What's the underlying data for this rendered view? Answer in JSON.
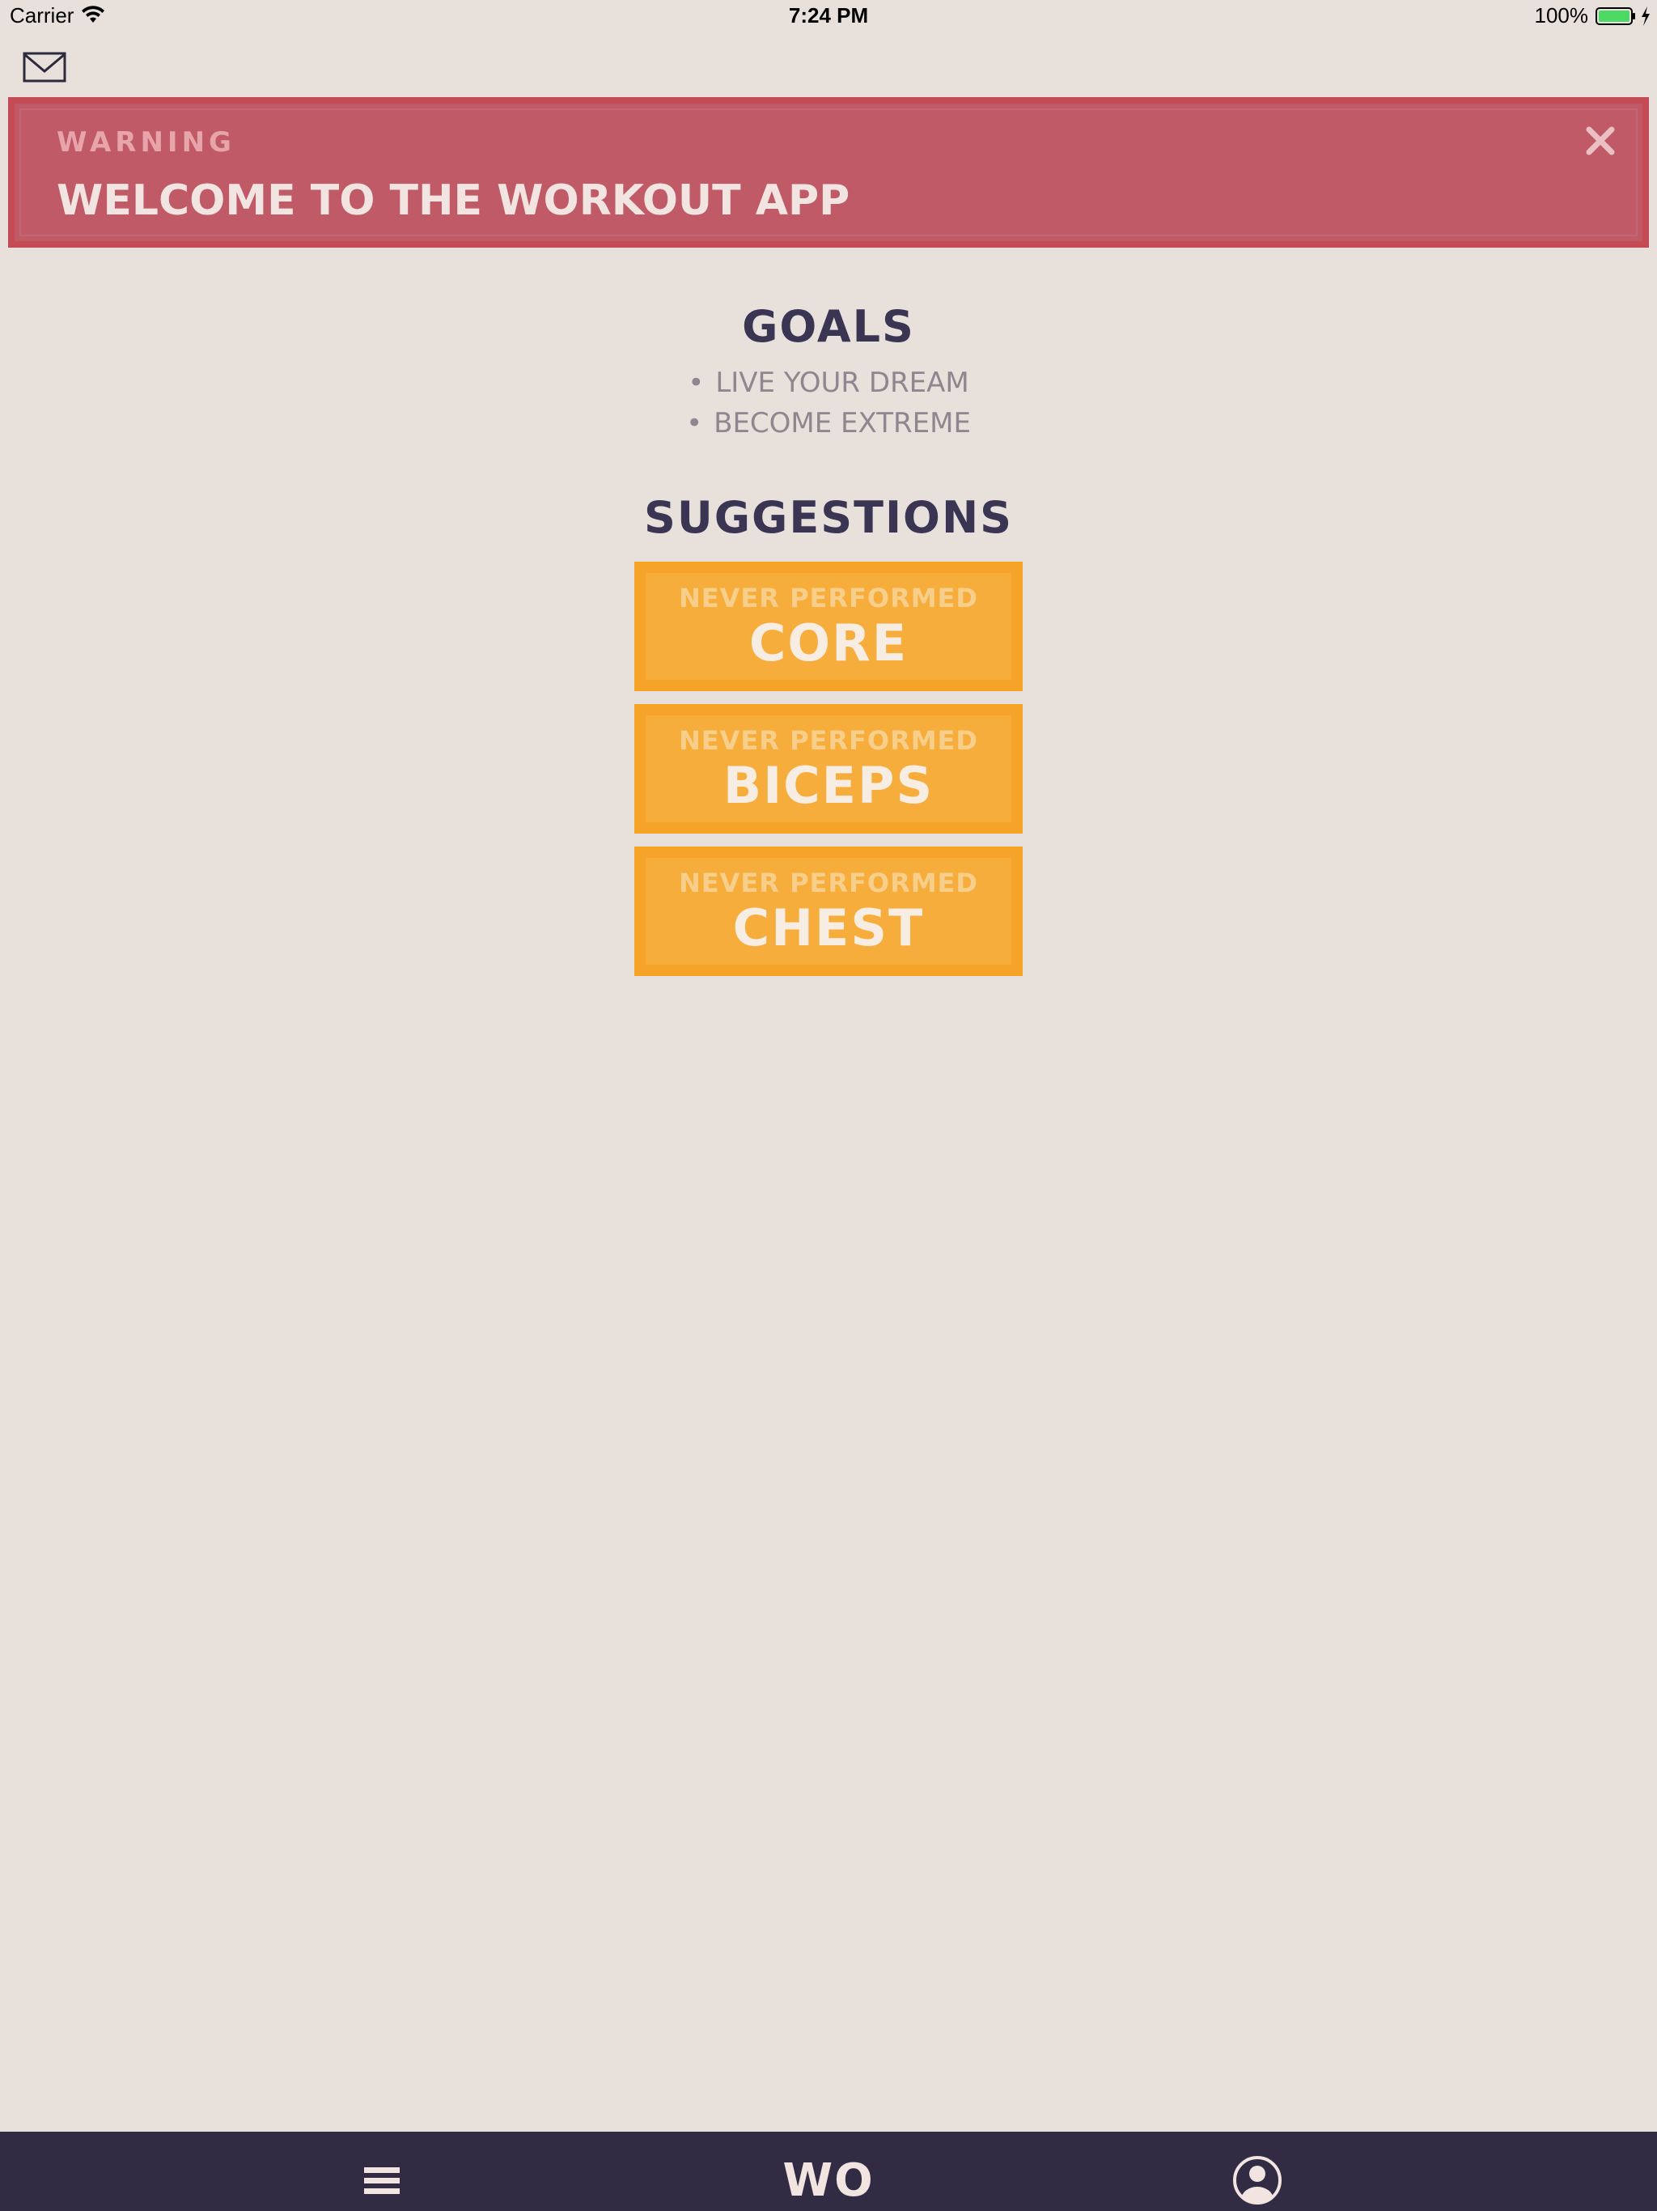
{
  "status_bar": {
    "carrier": "Carrier",
    "time": "7:24 PM",
    "battery": "100%",
    "battery_color": "#4cd964"
  },
  "header": {
    "mail_icon": "envelope-icon"
  },
  "banner": {
    "label": "WARNING",
    "message": "WELCOME TO THE WORKOUT APP",
    "close_icon": "close-icon",
    "color": "#c05a66"
  },
  "goals": {
    "heading": "GOALS",
    "items": [
      "LIVE YOUR DREAM",
      "BECOME EXTREME"
    ]
  },
  "suggestions": {
    "heading": "SUGGESTIONS",
    "color": "#f6ad3b",
    "cards": [
      {
        "subtitle": "NEVER PERFORMED",
        "title": "CORE"
      },
      {
        "subtitle": "NEVER PERFORMED",
        "title": "BICEPS"
      },
      {
        "subtitle": "NEVER PERFORMED",
        "title": "CHEST"
      }
    ]
  },
  "bottom_nav": {
    "menu_icon": "hamburger-menu-icon",
    "logo": "WO",
    "profile_icon": "user-profile-icon",
    "color": "#312c43"
  }
}
